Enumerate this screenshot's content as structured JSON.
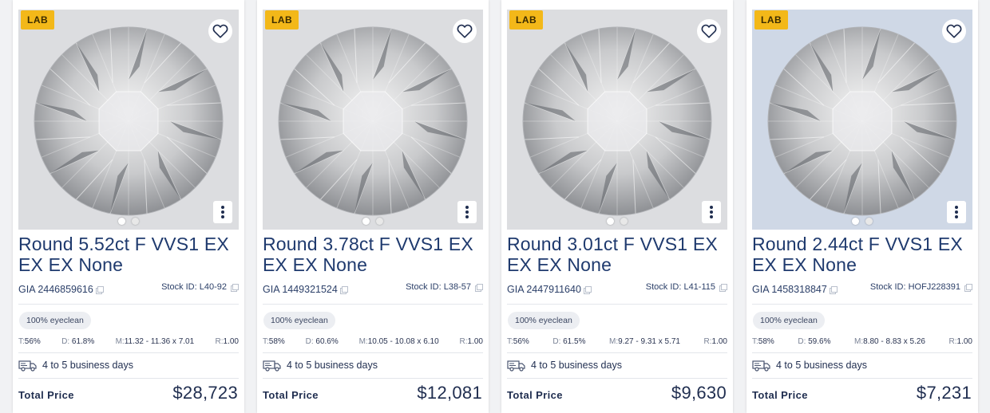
{
  "cards": [
    {
      "badge": "LAB",
      "title": "Round 5.52ct F VVS1 EX EX EX None",
      "cert": "GIA 2446859616",
      "stock": "Stock ID: L40-92",
      "eyeclean": "100% eyeclean",
      "t_label": "T:",
      "t_value": "56%",
      "d_label": "D:",
      "d_value": "61.8%",
      "m_label": "M:",
      "m_value": "11.32 - 11.36 x 7.01",
      "r_label": "R:",
      "r_value": "1.00",
      "shipping": "4 to 5 business days",
      "total_label": "Total Price",
      "price": "$28,723"
    },
    {
      "badge": "LAB",
      "title": "Round 3.78ct F VVS1 EX EX EX None",
      "cert": "GIA 1449321524",
      "stock": "Stock ID: L38-57",
      "eyeclean": "100% eyeclean",
      "t_label": "T:",
      "t_value": "58%",
      "d_label": "D:",
      "d_value": "60.6%",
      "m_label": "M:",
      "m_value": "10.05 - 10.08 x 6.10",
      "r_label": "R:",
      "r_value": "1.00",
      "shipping": "4 to 5 business days",
      "total_label": "Total Price",
      "price": "$12,081"
    },
    {
      "badge": "LAB",
      "title": "Round 3.01ct F VVS1 EX EX EX None",
      "cert": "GIA 2447911640",
      "stock": "Stock ID: L41-115",
      "eyeclean": "100% eyeclean",
      "t_label": "T:",
      "t_value": "56%",
      "d_label": "D:",
      "d_value": "61.5%",
      "m_label": "M:",
      "m_value": "9.27 - 9.31 x 5.71",
      "r_label": "R:",
      "r_value": "1.00",
      "shipping": "4 to 5 business days",
      "total_label": "Total Price",
      "price": "$9,630"
    },
    {
      "badge": "LAB",
      "title": "Round 2.44ct F VVS1 EX EX EX None",
      "cert": "GIA 1458318847",
      "stock": "Stock ID: HOFJ228391",
      "eyeclean": "100% eyeclean",
      "t_label": "T:",
      "t_value": "58%",
      "d_label": "D:",
      "d_value": "59.6%",
      "m_label": "M:",
      "m_value": "8.80 - 8.83 x 5.26",
      "r_label": "R:",
      "r_value": "1.00",
      "shipping": "4 to 5 business days",
      "total_label": "Total Price",
      "price": "$7,231"
    }
  ],
  "icons": {
    "favorite": "heart-outline-icon",
    "more": "vertical-dots-icon",
    "copy": "copy-icon",
    "shipping": "truck-icon"
  },
  "colors": {
    "badge": "#f3b819",
    "title": "#1f3a6e",
    "text": "#1f2d4f"
  }
}
